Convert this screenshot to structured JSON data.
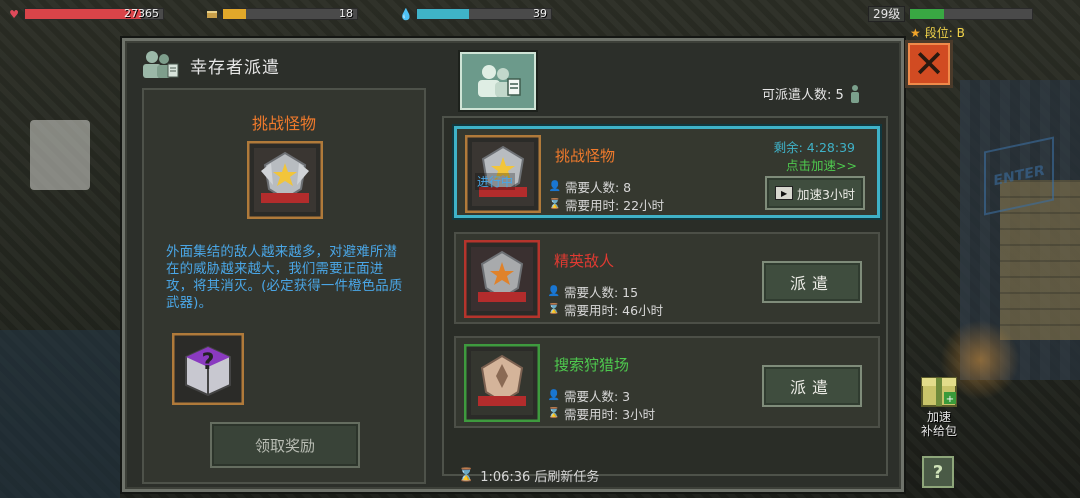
{
  "hud": {
    "health": {
      "value": "27365",
      "fraction": 0.84,
      "color": "#d94449",
      "icon": "heart-icon"
    },
    "food": {
      "value": "18",
      "fraction": 0.17,
      "color": "#e2a82a",
      "icon": "food-can-icon"
    },
    "water": {
      "value": "39",
      "fraction": 0.39,
      "color": "#3fb3c8",
      "icon": "water-drop-icon"
    },
    "level": {
      "label": "29级",
      "fraction": 0.28,
      "color": "#39a843"
    },
    "rank": "段位: B"
  },
  "panel": {
    "title": "幸存者派遣",
    "dispatch_count": "可派遣人数: 5",
    "close_symbol": "✕",
    "refresh_time": "1:06:36 后刷新任务"
  },
  "detail": {
    "title": "挑战怪物",
    "description": "外面集结的敌人越来越多，对避难所潜在的威胁越来越大，我们需要正面进攻，将其消灭。(必定获得一件橙色品质武器)。",
    "claim_label": "领取奖励"
  },
  "tasks": [
    {
      "name": "挑战怪物",
      "name_color": "#f07a2c",
      "people": "需要人数: 8",
      "time": "需要用时: 22小时",
      "status_tag": "进行中",
      "remaining": "剩余: 4:28:39",
      "speed_hint": "点击加速>>",
      "speed_button": "加速3小时",
      "badge_color": "#e0b84a"
    },
    {
      "name": "精英敌人",
      "name_color": "#e03a32",
      "people": "需要人数: 15",
      "time": "需要用时: 46小时",
      "dispatch_label": "派遣",
      "badge_color": "#d05a3a"
    },
    {
      "name": "搜索狩猎场",
      "name_color": "#4ec84e",
      "people": "需要人数: 3",
      "time": "需要用时: 3小时",
      "dispatch_label": "派遣",
      "badge_color": "#c8a086"
    }
  ],
  "side": {
    "supply_label_1": "加速",
    "supply_label_2": "补给包",
    "help_symbol": "?"
  }
}
